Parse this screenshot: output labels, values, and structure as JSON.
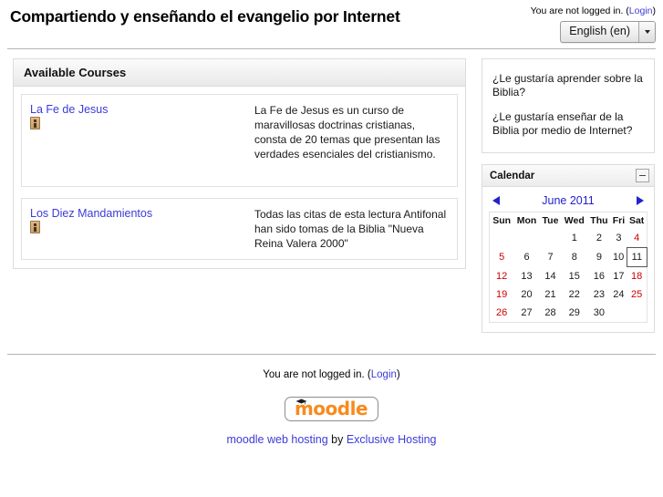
{
  "header": {
    "site_title": "Compartiendo y enseñando el evangelio por Internet",
    "login_text": "You are not logged in.",
    "login_open_paren": "(",
    "login_link": "Login",
    "login_close_paren": ")",
    "language_selected": "English (en)",
    "language_chevron_icon": "chevron-down-icon"
  },
  "main": {
    "courses_heading": "Available Courses",
    "courses": [
      {
        "name": "La Fe de Jesus",
        "summary_icon": "summary-info-icon",
        "summary": "La Fe de Jesus es un curso de maravillosas doctrinas cristianas, consta de 20 temas que presentan las verdades esenciales del cristianismo."
      },
      {
        "name": "Los Diez Mandamientos",
        "summary_icon": "summary-info-icon",
        "summary": "Todas las citas de esta lectura Antifonal han sido tomas de la Biblia \"Nueva Reina Valera 2000\""
      }
    ]
  },
  "sidebar": {
    "promo_block": {
      "line1": "¿Le gustaría aprender sobre la Biblia?",
      "line2": "¿Le gustaría enseñar de la Biblia por medio de Internet?"
    },
    "calendar_block": {
      "title": "Calendar",
      "minimize_icon": "minimize-icon",
      "prev_icon": "arrow-left-icon",
      "next_icon": "arrow-right-icon",
      "month_label": "June 2011",
      "weekday_headers": [
        "Sun",
        "Mon",
        "Tue",
        "Wed",
        "Thu",
        "Fri",
        "Sat"
      ],
      "weeks": [
        [
          {
            "d": "",
            "type": "empty"
          },
          {
            "d": "",
            "type": "empty"
          },
          {
            "d": "",
            "type": "empty"
          },
          {
            "d": "1",
            "type": "day"
          },
          {
            "d": "2",
            "type": "day"
          },
          {
            "d": "3",
            "type": "day"
          },
          {
            "d": "4",
            "type": "weekend"
          }
        ],
        [
          {
            "d": "5",
            "type": "weekend"
          },
          {
            "d": "6",
            "type": "day"
          },
          {
            "d": "7",
            "type": "day"
          },
          {
            "d": "8",
            "type": "day"
          },
          {
            "d": "9",
            "type": "day"
          },
          {
            "d": "10",
            "type": "day"
          },
          {
            "d": "11",
            "type": "today"
          }
        ],
        [
          {
            "d": "12",
            "type": "weekend"
          },
          {
            "d": "13",
            "type": "day"
          },
          {
            "d": "14",
            "type": "day"
          },
          {
            "d": "15",
            "type": "day"
          },
          {
            "d": "16",
            "type": "day"
          },
          {
            "d": "17",
            "type": "day"
          },
          {
            "d": "18",
            "type": "weekend"
          }
        ],
        [
          {
            "d": "19",
            "type": "weekend"
          },
          {
            "d": "20",
            "type": "day"
          },
          {
            "d": "21",
            "type": "day"
          },
          {
            "d": "22",
            "type": "day"
          },
          {
            "d": "23",
            "type": "day"
          },
          {
            "d": "24",
            "type": "day"
          },
          {
            "d": "25",
            "type": "weekend"
          }
        ],
        [
          {
            "d": "26",
            "type": "weekend"
          },
          {
            "d": "27",
            "type": "day"
          },
          {
            "d": "28",
            "type": "day"
          },
          {
            "d": "29",
            "type": "day"
          },
          {
            "d": "30",
            "type": "day"
          },
          {
            "d": "",
            "type": "empty"
          },
          {
            "d": "",
            "type": "empty"
          }
        ]
      ]
    }
  },
  "footer": {
    "login_text": "You are not logged in.",
    "login_open_paren": "(",
    "login_link": "Login",
    "login_close_paren": ")",
    "logo_word": "moodle",
    "logo_cap_icon": "graduation-cap-icon",
    "hosting_link_1": "moodle web hosting",
    "hosting_by": " by ",
    "hosting_link_2": "Exclusive Hosting"
  },
  "colors": {
    "link": "#3b3bd9",
    "calendar_link": "#2222cc",
    "weekend": "#cc0000",
    "moodle_orange": "#f78b1e",
    "rule": "#b3b3b3"
  }
}
